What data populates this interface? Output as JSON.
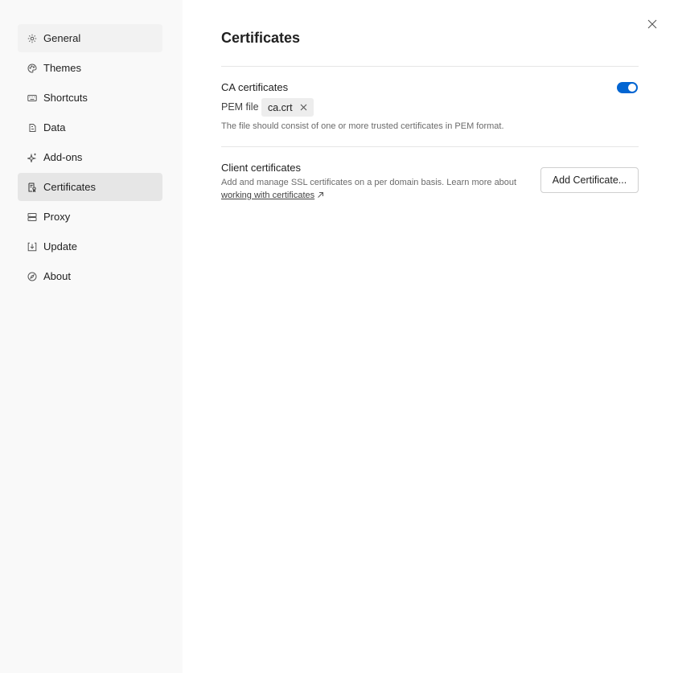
{
  "sidebar": {
    "items": [
      {
        "label": "General",
        "icon": "gear-icon"
      },
      {
        "label": "Themes",
        "icon": "palette-icon"
      },
      {
        "label": "Shortcuts",
        "icon": "keyboard-icon"
      },
      {
        "label": "Data",
        "icon": "database-icon"
      },
      {
        "label": "Add-ons",
        "icon": "sparkle-icon"
      },
      {
        "label": "Certificates",
        "icon": "certificate-icon"
      },
      {
        "label": "Proxy",
        "icon": "proxy-icon"
      },
      {
        "label": "Update",
        "icon": "download-icon"
      },
      {
        "label": "About",
        "icon": "compass-icon"
      }
    ],
    "active": "Certificates"
  },
  "page": {
    "title": "Certificates",
    "close_icon": "close-icon"
  },
  "ca": {
    "label": "CA certificates",
    "enabled": true,
    "pem_label": "PEM file",
    "file_name": "ca.crt",
    "help": "The file should consist of one or more trusted certificates in PEM format."
  },
  "client": {
    "label": "Client certificates",
    "desc_prefix": "Add and manage SSL certificates on a per domain basis. Learn more about ",
    "link": "working with certificates",
    "button": "Add Certificate..."
  },
  "colors": {
    "accent": "#0265d2",
    "sidebar_bg": "#f9f9f9",
    "active_item_bg": "#e6e6e6"
  }
}
